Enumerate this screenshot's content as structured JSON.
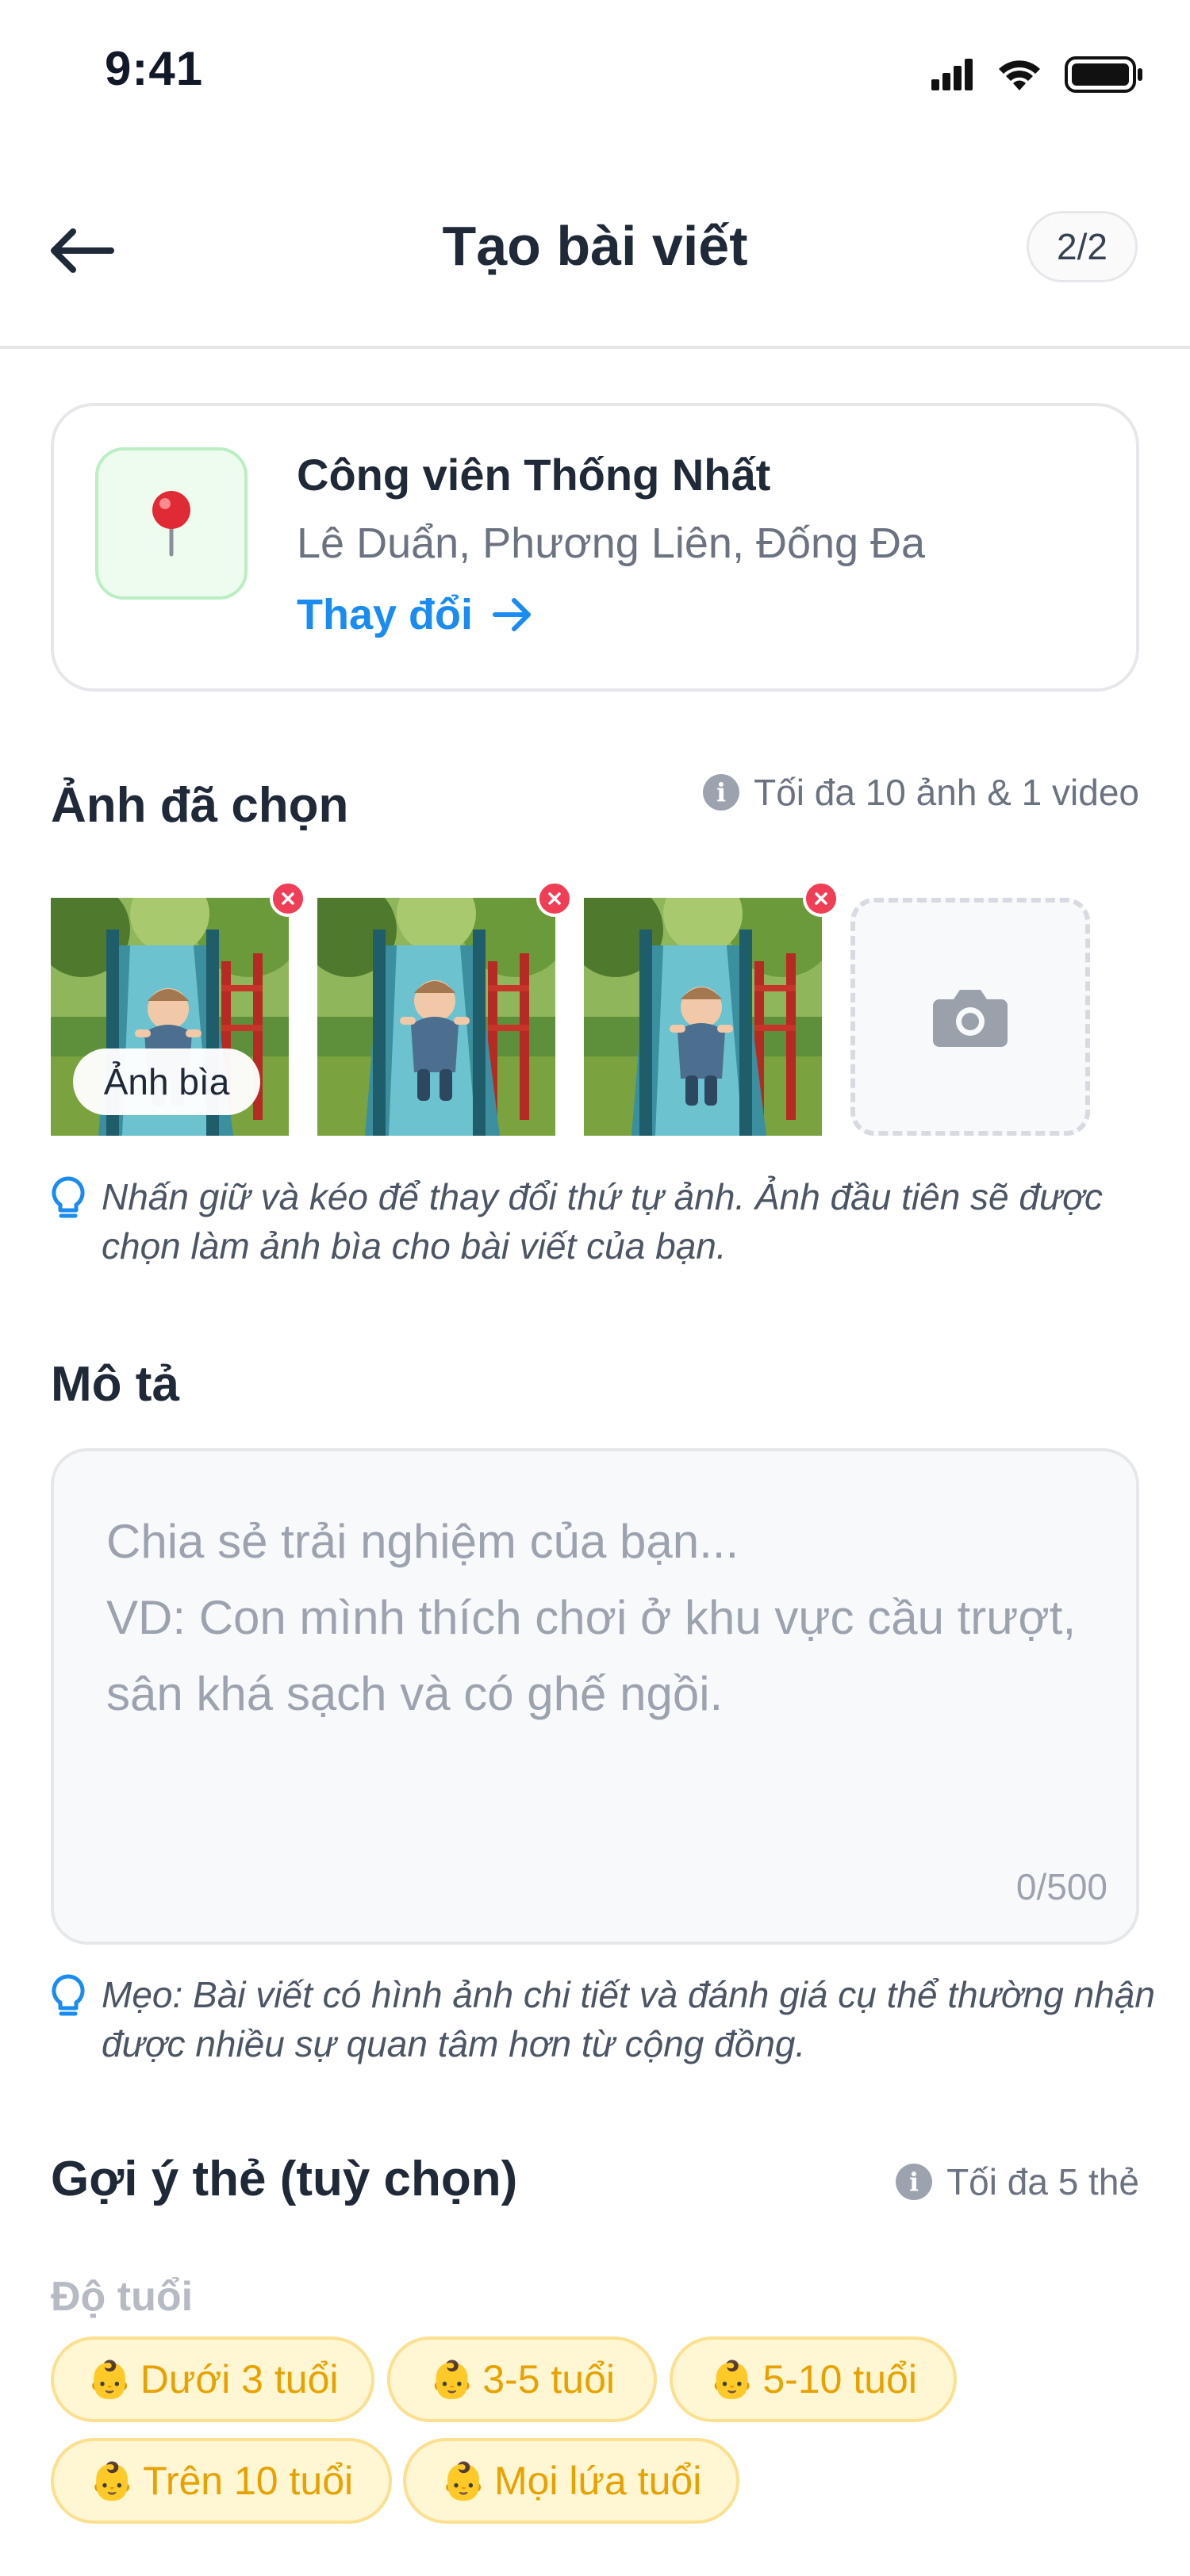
{
  "status_bar": {
    "time": "9:41",
    "icons": [
      "signal-icon",
      "wifi-icon",
      "battery-icon"
    ]
  },
  "header": {
    "title": "Tạo bài viết",
    "step": "2/2",
    "back_icon": "arrow-left-icon"
  },
  "location": {
    "icon": "pushpin-icon",
    "name": "Công viên Thống Nhất",
    "address": "Lê Duẩn, Phương Liên, Đống Đa",
    "change_label": "Thay đổi",
    "change_icon": "arrow-right-icon"
  },
  "photos_section": {
    "title": "Ảnh đã chọn",
    "note": "Tối đa 10 ảnh & 1 video",
    "cover_label": "Ảnh bìa",
    "photos": [
      {
        "subject": "baby-on-slide-photo"
      },
      {
        "subject": "baby-on-slide-photo"
      },
      {
        "subject": "baby-on-slide-photo"
      }
    ],
    "add_icon": "camera-icon",
    "hint": "Nhấn giữ và kéo để thay đổi thứ tự ảnh. Ảnh đầu tiên sẽ được chọn làm ảnh bìa cho bài viết của bạn."
  },
  "description": {
    "title": "Mô tả",
    "placeholder": "Chia sẻ trải nghiệm của bạn...\nVD: Con mình thích chơi ở khu vực cầu trượt, sân khá sạch và có ghế ngồi.",
    "counter": "0/500",
    "tip": "Mẹo: Bài viết có hình ảnh chi tiết và đánh giá cụ thể thường nhận được nhiều sự quan tâm hơn từ cộng đồng."
  },
  "tags": {
    "title": "Gợi ý thẻ (tuỳ chọn)",
    "note": "Tối đa 5 thẻ",
    "group_label": "Độ tuổi",
    "age_chips": [
      {
        "emoji": "👶",
        "label": "Dưới 3 tuổi"
      },
      {
        "emoji": "👶",
        "label": "3-5 tuổi"
      },
      {
        "emoji": "👶",
        "label": "5-10 tuổi"
      },
      {
        "emoji": "👶",
        "label": "Trên 10 tuổi"
      },
      {
        "emoji": "👶",
        "label": "Mọi lứa tuổi"
      }
    ]
  },
  "colors": {
    "accent": "#1a8cf0",
    "remove": "#ef3e55",
    "chip_bg": "#fff6d4",
    "chip_text": "#e8a200"
  }
}
